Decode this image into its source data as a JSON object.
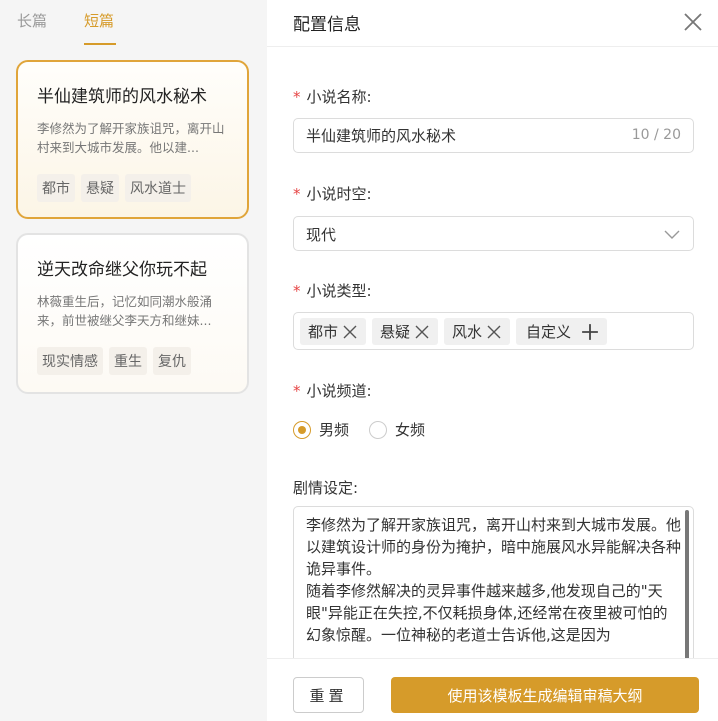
{
  "tabs": [
    {
      "label": "长篇",
      "active": false
    },
    {
      "label": "短篇",
      "active": true
    }
  ],
  "cards": [
    {
      "title": "半仙建筑师的风水秘术",
      "desc": "李修然为了解开家族诅咒，离开山村来到大城市发展。他以建...",
      "tags": [
        "都市",
        "悬疑",
        "风水道士"
      ],
      "selected": true
    },
    {
      "title": "逆天改命继父你玩不起",
      "desc": "林薇重生后，记忆如同潮水般涌来，前世被继父李天方和继妹...",
      "tags": [
        "现实情感",
        "重生",
        "复仇"
      ],
      "selected": false
    }
  ],
  "panel": {
    "title": "配置信息",
    "name_label": "小说名称:",
    "name_value": "半仙建筑师的风水秘术",
    "name_counter": "10 / 20",
    "era_label": "小说时空:",
    "era_value": "现代",
    "type_label": "小说类型:",
    "type_chips": [
      "都市",
      "悬疑",
      "风水"
    ],
    "type_custom": "自定义",
    "channel_label": "小说频道:",
    "channel_options": [
      {
        "label": "男频",
        "selected": true
      },
      {
        "label": "女频",
        "selected": false
      }
    ],
    "plot_label": "剧情设定:",
    "plot_text": "李修然为了解开家族诅咒，离开山村来到大城市发展。他以建筑设计师的身份为掩护，暗中施展风水异能解决各种诡异事件。\n随着李修然解决的灵异事件越来越多,他发现自己的\"天眼\"异能正在失控,不仅耗损身体,还经常在夜里被可怕的幻象惊醒。一位神秘的老道士告诉他,这是因为"
  },
  "footer": {
    "reset_label": "重置",
    "generate_label": "使用该模板生成编辑审稿大纲"
  },
  "colors": {
    "accent": "#d69b2a",
    "required": "#e64545"
  }
}
